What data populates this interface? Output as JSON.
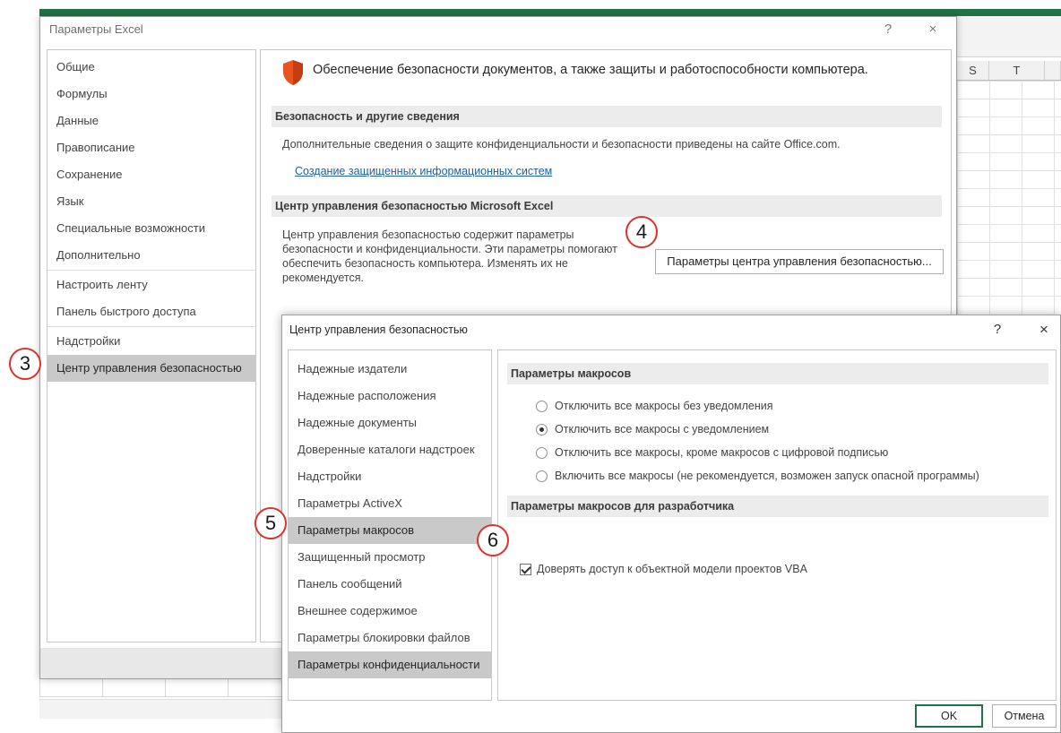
{
  "excel": {
    "column_s": "S",
    "column_t": "T"
  },
  "options_dialog": {
    "title": "Параметры Excel",
    "help": "?",
    "close": "×",
    "nav_top": [
      "Общие",
      "Формулы",
      "Данные",
      "Правописание",
      "Сохранение",
      "Язык",
      "Специальные возможности",
      "Дополнительно"
    ],
    "nav_mid": [
      "Настроить ленту",
      "Панель быстрого доступа"
    ],
    "nav_bottom": [
      "Надстройки",
      "Центр управления безопасностью"
    ],
    "selected": "Центр управления безопасностью",
    "header": "Обеспечение безопасности документов, а также защиты и работоспособности компьютера.",
    "section1_title": "Безопасность и другие сведения",
    "section1_text": "Дополнительные сведения о защите конфиденциальности и безопасности приведены на сайте Office.com.",
    "section1_link": "Создание защищенных информационных систем",
    "section2_title": "Центр управления безопасностью Microsoft Excel",
    "section2_text": "Центр управления безопасностью содержит параметры безопасности и конфиденциальности. Эти параметры помогают обеспечить безопасность компьютера. Изменять их не рекомендуется.",
    "trust_center_button": "Параметры центра управления безопасностью..."
  },
  "trust_center": {
    "title": "Центр управления безопасностью",
    "help": "?",
    "close": "×",
    "nav": [
      "Надежные издатели",
      "Надежные расположения",
      "Надежные документы",
      "Доверенные каталоги надстроек",
      "Надстройки",
      "Параметры ActiveX",
      "Параметры макросов",
      "Защищенный просмотр",
      "Панель сообщений",
      "Внешнее содержимое",
      "Параметры блокировки файлов",
      "Параметры конфиденциальности"
    ],
    "selected": "Параметры макросов",
    "macro_section": "Параметры макросов",
    "macro_options": [
      {
        "label": "Отключить все макросы без уведомления",
        "checked": false
      },
      {
        "label": "Отключить все макросы с уведомлением",
        "checked": true
      },
      {
        "label": "Отключить все макросы, кроме макросов с цифровой подписью",
        "checked": false
      },
      {
        "label": "Включить все макросы (не рекомендуется, возможен запуск опасной программы)",
        "checked": false
      }
    ],
    "dev_section": "Параметры макросов для разработчика",
    "vba_checkbox": {
      "label": "Доверять доступ к объектной модели проектов VBA",
      "checked": true
    },
    "ok": "OK",
    "cancel": "Отмена"
  },
  "steps": {
    "s3": "3",
    "s4": "4",
    "s5": "5",
    "s6": "6"
  },
  "colors": {
    "accent_green": "#217346",
    "marker_red": "#e0302a",
    "link_blue": "#1e5fa8",
    "selected_gray": "#c9c9c9"
  }
}
